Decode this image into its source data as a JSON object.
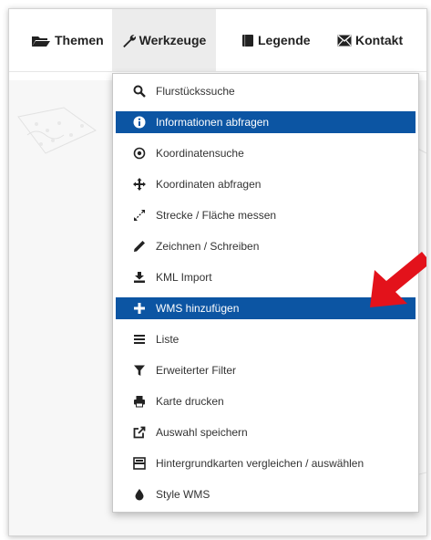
{
  "navbar": {
    "items": [
      {
        "label": "Themen",
        "icon": "folder-open-icon"
      },
      {
        "label": "Werkzeuge",
        "icon": "wrench-icon",
        "active": true
      },
      {
        "label": "Legende",
        "icon": "book-icon"
      },
      {
        "label": "Kontakt",
        "icon": "envelope-icon"
      }
    ]
  },
  "dropdown": {
    "items": [
      {
        "label": "Flurstückssuche",
        "icon": "search-icon"
      },
      {
        "label": "Informationen abfragen",
        "icon": "info-circle-icon",
        "highlighted": true
      },
      {
        "label": "Koordinatensuche",
        "icon": "crosshair-icon"
      },
      {
        "label": "Koordinaten abfragen",
        "icon": "move-arrows-icon"
      },
      {
        "label": "Strecke / Fläche messen",
        "icon": "measure-diagonal-icon"
      },
      {
        "label": "Zeichnen / Schreiben",
        "icon": "pencil-icon"
      },
      {
        "label": "KML Import",
        "icon": "import-icon"
      },
      {
        "label": "WMS hinzufügen",
        "icon": "plus-icon",
        "highlighted": true
      },
      {
        "label": "Liste",
        "icon": "list-icon"
      },
      {
        "label": "Erweiterter Filter",
        "icon": "filter-icon"
      },
      {
        "label": "Karte drucken",
        "icon": "print-icon"
      },
      {
        "label": "Auswahl speichern",
        "icon": "share-icon"
      },
      {
        "label": "Hintergrundkarten vergleichen / auswählen",
        "icon": "compare-layout-icon"
      },
      {
        "label": "Style WMS",
        "icon": "drop-icon"
      }
    ]
  },
  "colors": {
    "highlight": "#0c55a3",
    "arrow": "#e3121b"
  }
}
